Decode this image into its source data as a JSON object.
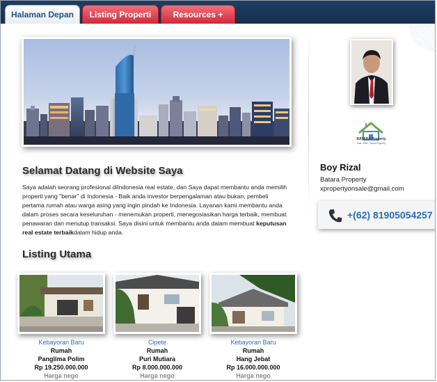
{
  "nav": {
    "tabs": [
      {
        "label": "Halaman Depan"
      },
      {
        "label": "Listing Properti"
      },
      {
        "label": "Resources +"
      }
    ]
  },
  "welcome": {
    "title": "Selamat Datang di Website Saya",
    "para_part1": "Saya adalah seorang profesional diIndonesia real estate, dan Saya dapat membantu anda memilih properti yang \"benar\" di Indonesia - Baik anda investor berpengalaman atau bukan, pembeli pertama rumah atau warga asing yang ingin pindah ke Indonesia. Layanan kami membantu anda dalam proses secara keseluruhan - menemukan properti, menegosiasikan harga terbaik, membuat penawaran dan menutup transaksi. Saya disini untuk membantu anda dalam membuat ",
    "para_bold": "keputusan real estate terbaik",
    "para_part2": "dalam hidup anda."
  },
  "listing": {
    "title": "Listing Utama",
    "items": [
      {
        "location": "Kebayoran Baru",
        "type": "Rumah",
        "name": "Panglima Polim",
        "price": "Rp 19.250.000.000",
        "note": "Harga nego"
      },
      {
        "location": "Cipete",
        "type": "Rumah",
        "name": "Puri Mutiara",
        "price": "Rp 8.000.000.000",
        "note": "Harga nego"
      },
      {
        "location": "Kebayoran Baru",
        "type": "Rumah",
        "name": "Hang Jebat",
        "price": "Rp 16.000.000.000",
        "note": "Harga nego"
      }
    ]
  },
  "agent": {
    "name": "Boy Rizal",
    "company": "Batara Property",
    "email": "xpropertyonsale@gmail.com",
    "phone": "+(62) 81905054257",
    "logo_title": "BATARA Property",
    "logo_sub": "Jual - Beli - Sewa Property"
  },
  "colors": {
    "nav_bg": "#16304f",
    "tab_red": "#d2293a",
    "link_blue": "#2a6bb8"
  }
}
